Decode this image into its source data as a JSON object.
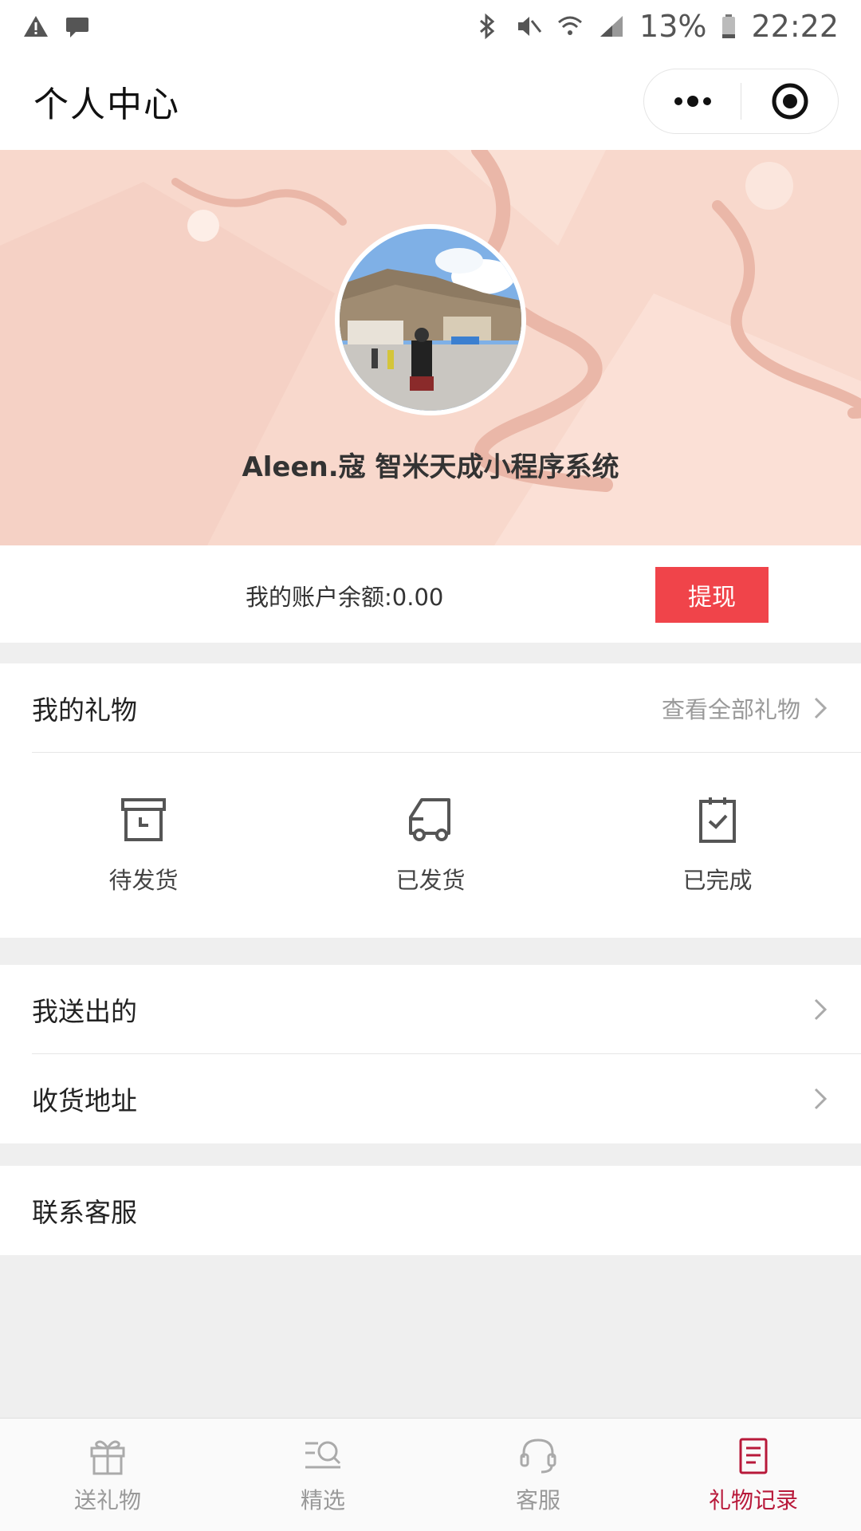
{
  "status_bar": {
    "battery": "13%",
    "time": "22:22"
  },
  "nav": {
    "title": "个人中心"
  },
  "profile": {
    "username": "Aleen.寇 智米天成小程序系统"
  },
  "balance": {
    "label": "我的账户余额:0.00",
    "withdraw_label": "提现"
  },
  "gifts": {
    "title": "我的礼物",
    "view_all": "查看全部礼物",
    "statuses": [
      {
        "label": "待发货",
        "icon": "box-icon"
      },
      {
        "label": "已发货",
        "icon": "truck-icon"
      },
      {
        "label": "已完成",
        "icon": "clipboard-check-icon"
      }
    ]
  },
  "menu": {
    "sent": "我送出的",
    "address": "收货地址",
    "service": "联系客服"
  },
  "tabbar": {
    "items": [
      {
        "label": "送礼物",
        "icon": "gift-icon"
      },
      {
        "label": "精选",
        "icon": "search-list-icon"
      },
      {
        "label": "客服",
        "icon": "headset-icon"
      },
      {
        "label": "礼物记录",
        "icon": "document-icon"
      }
    ],
    "active_color": "#b8193a"
  },
  "colors": {
    "banner": "#f8d8cc",
    "withdraw": "#f0444a"
  }
}
